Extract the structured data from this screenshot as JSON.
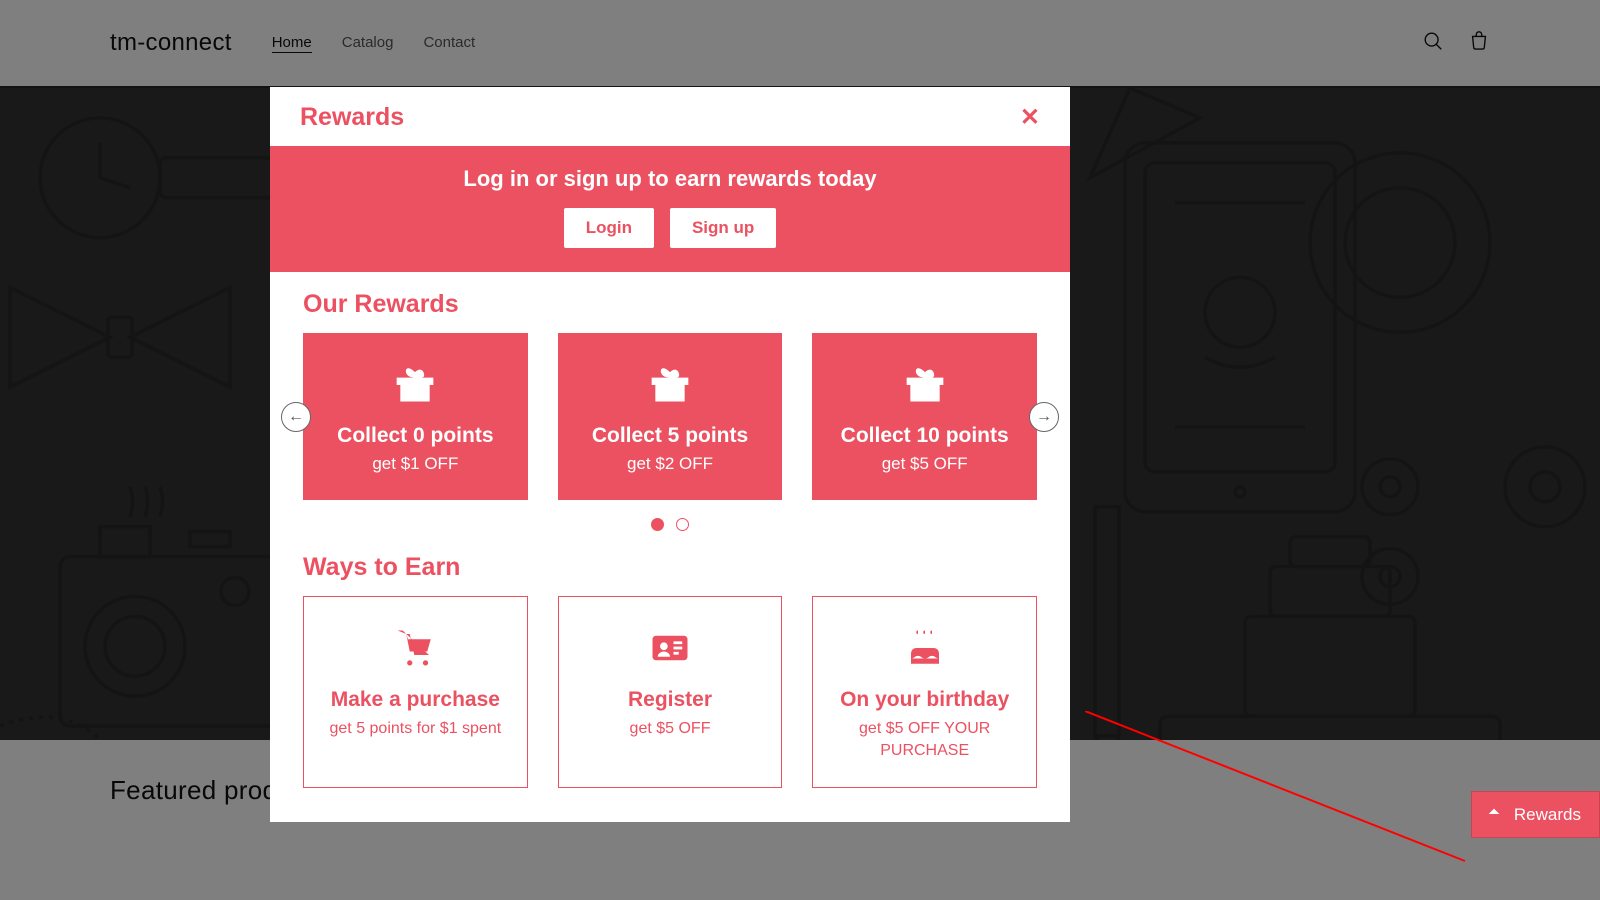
{
  "header": {
    "brand": "tm-connect",
    "nav": [
      "Home",
      "Catalog",
      "Contact"
    ]
  },
  "featured_title": "Featured products",
  "modal": {
    "title": "Rewards",
    "banner_title": "Log in or sign up to earn rewards today",
    "login_label": "Login",
    "signup_label": "Sign up",
    "our_rewards_title": "Our Rewards",
    "rewards": [
      {
        "title": "Collect 0 points",
        "sub": "get $1 OFF"
      },
      {
        "title": "Collect 5 points",
        "sub": "get $2 OFF"
      },
      {
        "title": "Collect 10 points",
        "sub": "get $5 OFF"
      }
    ],
    "ways_title": "Ways to Earn",
    "ways": [
      {
        "title": "Make a purchase",
        "sub": "get 5 points for $1 spent"
      },
      {
        "title": "Register",
        "sub": "get $5 OFF"
      },
      {
        "title": "On your birthday",
        "sub": "get $5 OFF YOUR PURCHASE"
      }
    ]
  },
  "fab_label": "Rewards"
}
